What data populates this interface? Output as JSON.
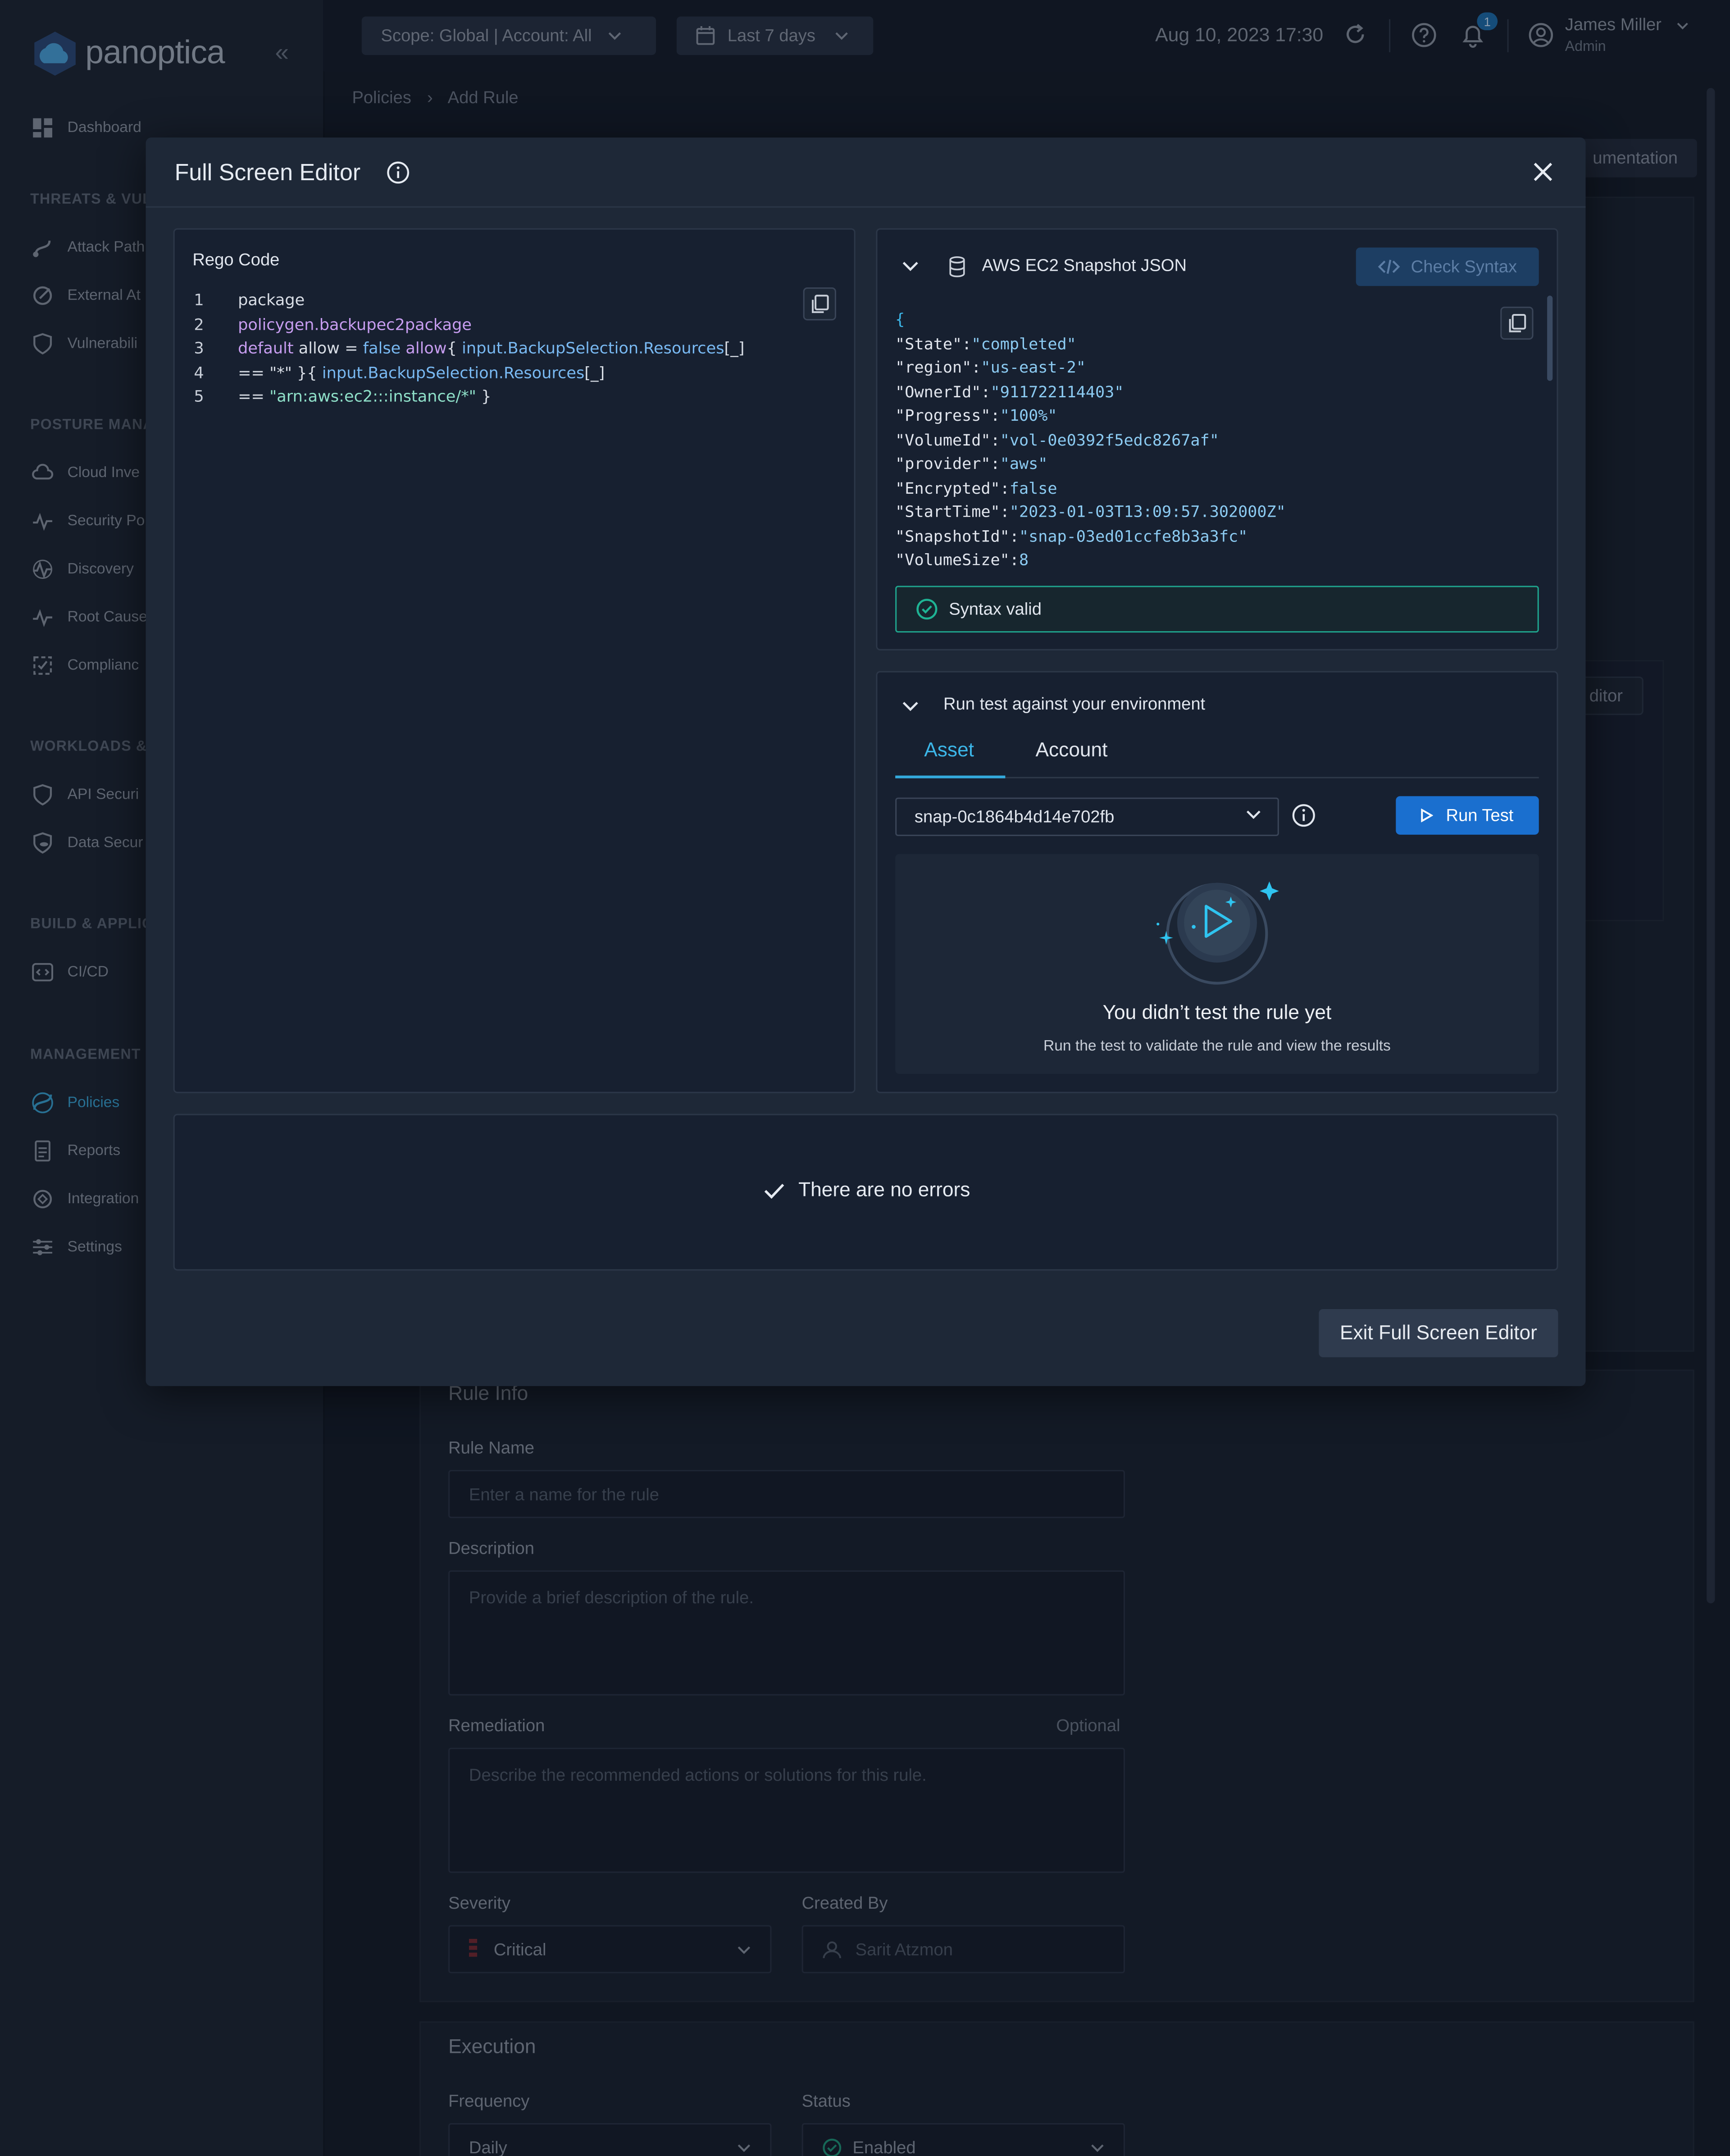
{
  "app": {
    "logo_text": "panoptica"
  },
  "sidebar": {
    "items": [
      {
        "label": "Dashboard"
      },
      {
        "label": "Attack Path"
      },
      {
        "label": "External At"
      },
      {
        "label": "Vulnerabili"
      },
      {
        "label": "Cloud Inve"
      },
      {
        "label": "Security Po"
      },
      {
        "label": "Discovery"
      },
      {
        "label": "Root Cause"
      },
      {
        "label": "Complianc"
      },
      {
        "label": "API Securi"
      },
      {
        "label": "Data Secur"
      },
      {
        "label": "CI/CD"
      },
      {
        "label": "Policies"
      },
      {
        "label": "Reports"
      },
      {
        "label": "Integration"
      },
      {
        "label": "Settings"
      }
    ],
    "sections": [
      "THREATS & VUL",
      "POSTURE MANA",
      "WORKLOADS &",
      "BUILD & APPLIC",
      "MANAGEMENT"
    ]
  },
  "topbar": {
    "scope_label": "Scope: Global | Account: All",
    "date_range_label": "Last 7 days",
    "datetime": "Aug 10, 2023 17:30",
    "notification_count": "1",
    "user_name": "James Miller",
    "user_role": "Admin"
  },
  "breadcrumb": {
    "parent": "Policies",
    "current": "Add Rule"
  },
  "background": {
    "doc_button": "umentation",
    "editor_button": "ditor",
    "rule_info": {
      "title": "Rule Info",
      "name_label": "Rule Name",
      "name_placeholder": "Enter a name for the rule",
      "description_label": "Description",
      "description_placeholder": "Provide a brief description of the rule.",
      "remediation_label": "Remediation",
      "optional_label": "Optional",
      "remediation_placeholder": "Describe the recommended actions or solutions for this rule.",
      "severity_label": "Severity",
      "severity_value": "Critical",
      "created_by_label": "Created By",
      "created_by_value": "Sarit Atzmon"
    },
    "execution": {
      "title": "Execution",
      "frequency_label": "Frequency",
      "frequency_value": "Daily",
      "status_label": "Status",
      "status_value": "Enabled"
    }
  },
  "modal": {
    "title": "Full Screen Editor",
    "code_panel": {
      "label": "Rego Code",
      "lines": [
        {
          "num": "1",
          "tokens": [
            {
              "t": "package",
              "c": "tk-plain"
            }
          ]
        },
        {
          "num": "2",
          "tokens": [
            {
              "t": "policygen.backupec2package",
              "c": "tk-kw"
            }
          ]
        },
        {
          "num": "3",
          "tokens": [
            {
              "t": "default",
              "c": "tk-kw"
            },
            {
              "t": " allow = ",
              "c": "tk-plain"
            },
            {
              "t": "false",
              "c": "tk-fn"
            },
            {
              "t": " allow",
              "c": "tk-kw"
            },
            {
              "t": "{ ",
              "c": "tk-plain"
            },
            {
              "t": "input.BackupSelection.Resources",
              "c": "tk-fn"
            },
            {
              "t": "[_]",
              "c": "tk-plain"
            }
          ]
        },
        {
          "num": "4",
          "tokens": [
            {
              "t": "== \"*\" }{ ",
              "c": "tk-plain"
            },
            {
              "t": "input.BackupSelection.Resources",
              "c": "tk-fn"
            },
            {
              "t": "[_]",
              "c": "tk-plain"
            }
          ]
        },
        {
          "num": "5",
          "tokens": [
            {
              "t": "== ",
              "c": "tk-plain"
            },
            {
              "t": "\"arn:aws:ec2:::instance/*\"",
              "c": "tk-str"
            },
            {
              "t": " }",
              "c": "tk-plain"
            }
          ]
        }
      ]
    },
    "json_panel": {
      "title": "AWS EC2 Snapshot JSON",
      "check_syntax_label": "Check Syntax",
      "open_brace": "{",
      "entries": [
        {
          "k": "\"State\"",
          "v": "\"completed\""
        },
        {
          "k": "\"region\"",
          "v": "\"us-east-2\""
        },
        {
          "k": "\"OwnerId\"",
          "v": "\"911722114403\""
        },
        {
          "k": "\"Progress\"",
          "v": "\"100%\""
        },
        {
          "k": "\"VolumeId\"",
          "v": "\"vol-0e0392f5edc8267af\""
        },
        {
          "k": "\"provider\"",
          "v": "\"aws\""
        },
        {
          "k": "\"Encrypted\"",
          "v": "false"
        },
        {
          "k": "\"StartTime\"",
          "v": "\"2023-01-03T13:09:57.302000Z\""
        },
        {
          "k": "\"SnapshotId\"",
          "v": "\"snap-03ed01ccfe8b3a3fc\""
        },
        {
          "k": "\"VolumeSize\"",
          "v": "8"
        }
      ],
      "syntax_status": "Syntax valid"
    },
    "run_panel": {
      "title": "Run test against your environment",
      "tabs": [
        "Asset",
        "Account"
      ],
      "selected_asset": "snap-0c1864b4d14e702fb",
      "run_label": "Run Test",
      "empty_title": "You didn’t test the rule yet",
      "empty_subtitle": "Run the test to validate the rule and view the results"
    },
    "errors_text": "There are no errors",
    "exit_label": "Exit Full Screen Editor"
  },
  "colors": {
    "accent": "#33a9dc",
    "primary_button": "#1a6fcf",
    "valid": "#1fa58e",
    "background": "#141c29"
  }
}
